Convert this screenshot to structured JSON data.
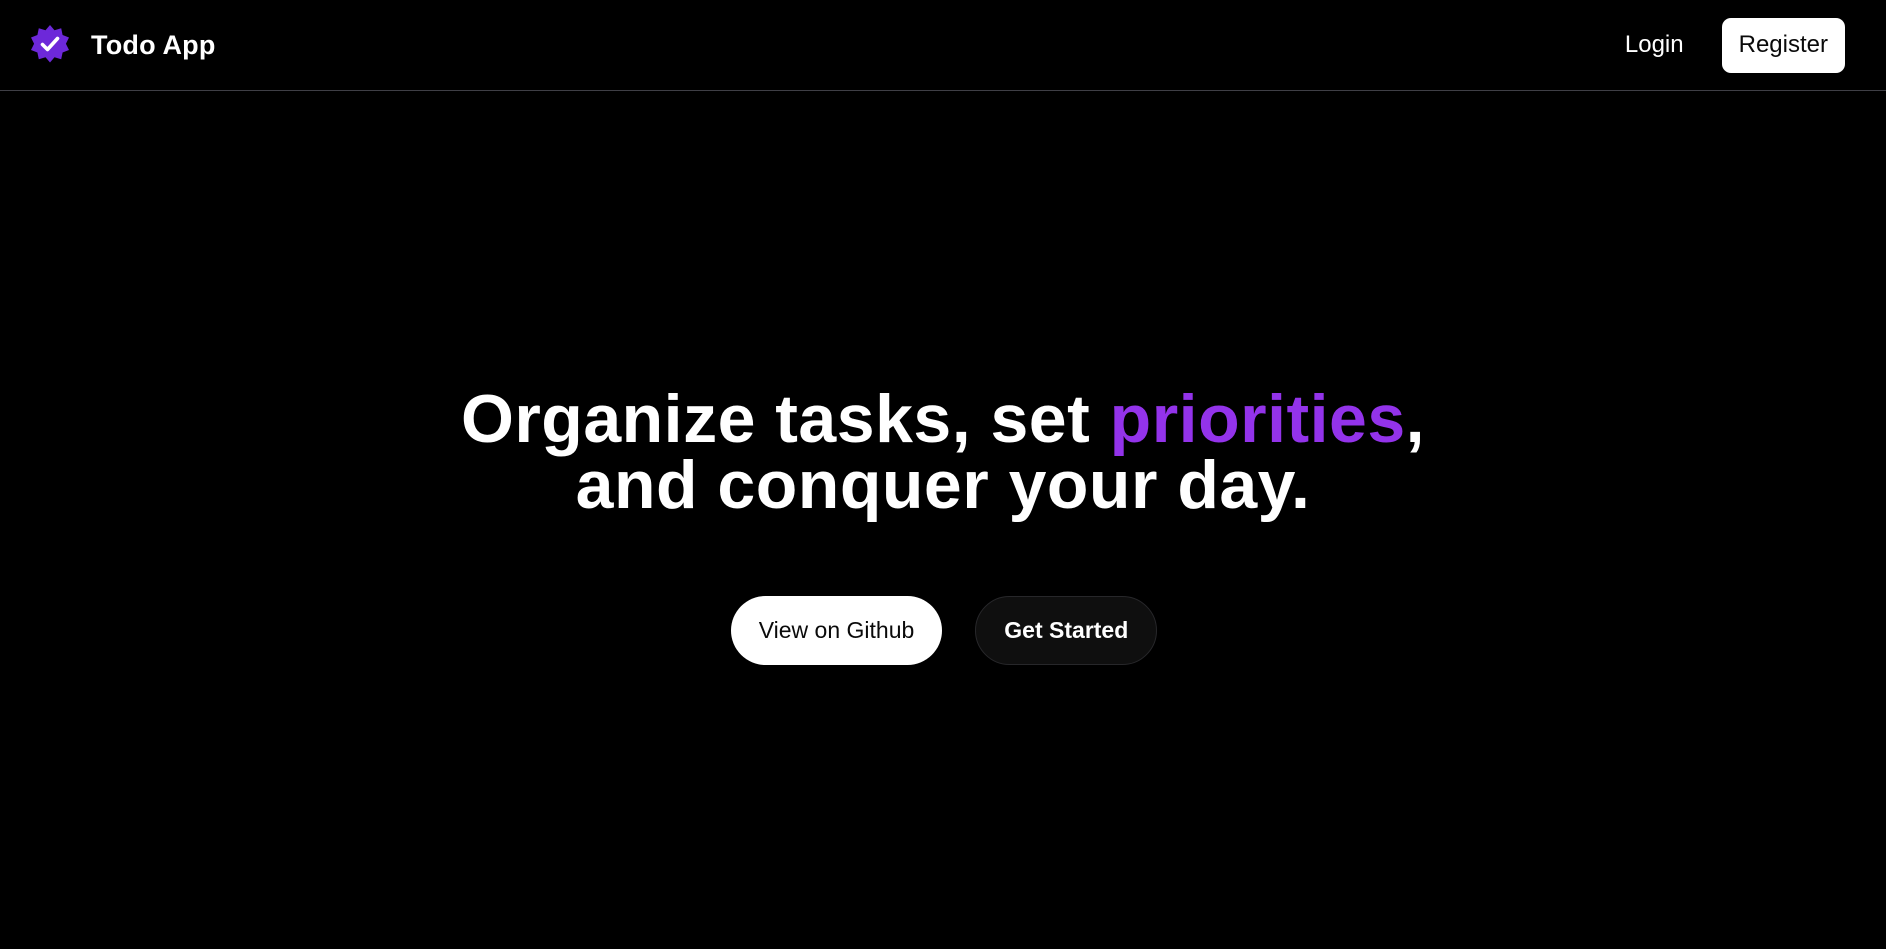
{
  "header": {
    "brand_name": "Todo App",
    "brand_icon": "check-badge-icon",
    "login_label": "Login",
    "register_label": "Register"
  },
  "hero": {
    "title_part1": "Organize tasks, set ",
    "title_accent": "priorities",
    "title_part2": ",",
    "title_line2": "and conquer your day.",
    "github_label": "View on Github",
    "start_label": "Get Started"
  },
  "colors": {
    "background": "#000000",
    "accent": "#9333ea",
    "brand_icon": "#6d28d9",
    "text": "#ffffff",
    "divider": "#3f3f46"
  }
}
